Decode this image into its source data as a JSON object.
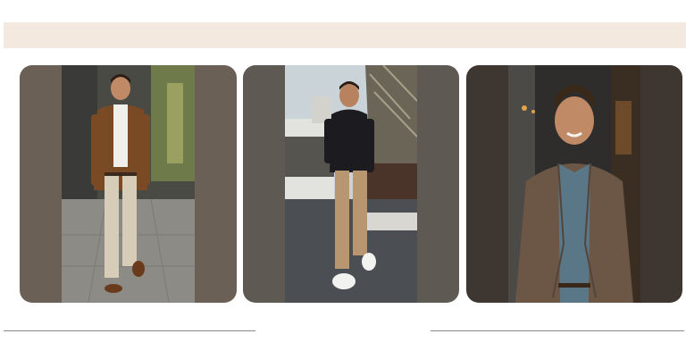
{
  "banner": {
    "text": ""
  },
  "gallery": {
    "cards": [
      {
        "name": "outfit-card-1",
        "scene": "brown-blazer-white-shirt-beige-chinos"
      },
      {
        "name": "outfit-card-2",
        "scene": "black-shirt-khaki-chinos-white-sneakers"
      },
      {
        "name": "outfit-card-3",
        "scene": "tweed-jacket-denim-shirt-portrait"
      }
    ]
  },
  "colors": {
    "banner": "#f3e9df",
    "card1_bg": "#6b6056",
    "card2_bg": "#5e5a53",
    "card3_bg": "#3e3731",
    "divider": "#8a8a8a"
  }
}
